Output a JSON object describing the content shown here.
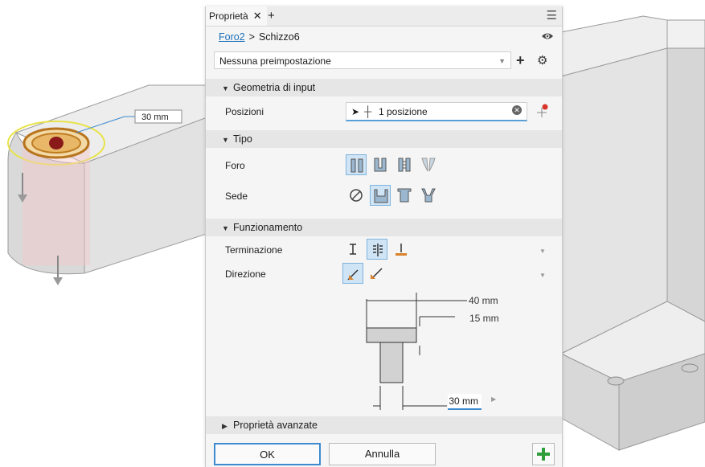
{
  "viewport": {
    "dimension_label": "30 mm"
  },
  "panel": {
    "tab_label": "Proprietà",
    "tab_close": "✕",
    "tab_add": "+",
    "menu_icon": "hamburger-icon",
    "breadcrumb": {
      "parent": "Foro2",
      "separator": ">",
      "current": "Schizzo6"
    },
    "preset": {
      "value": "Nessuna preimpostazione",
      "add": "+",
      "gear_icon": "gear-icon"
    },
    "sections": {
      "input_geometry": "Geometria di input",
      "type": "Tipo",
      "behavior": "Funzionamento",
      "advanced": "Proprietà avanzate"
    },
    "positions": {
      "label": "Posizioni",
      "value": "1 posizione"
    },
    "type": {
      "hole_label": "Foro",
      "seat_label": "Sede"
    },
    "behavior": {
      "termination_label": "Terminazione",
      "direction_label": "Direzione"
    },
    "diagram": {
      "diameter_top": "40 mm",
      "depth": "15 mm",
      "diameter_bottom": "30 mm"
    },
    "buttons": {
      "ok": "OK",
      "cancel": "Annulla",
      "apply": "+"
    },
    "accent_color": "#3d8ad0",
    "apply_color": "#2f9e3a"
  }
}
